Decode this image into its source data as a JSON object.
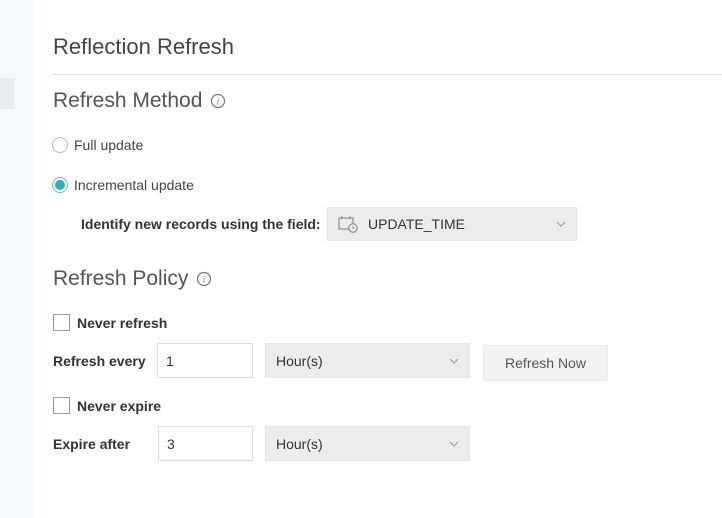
{
  "page_title": "Reflection Refresh",
  "refresh_method": {
    "heading": "Refresh Method",
    "options": [
      {
        "label": "Full update",
        "selected": false
      },
      {
        "label": "Incremental update",
        "selected": true
      }
    ],
    "field_label": "Identify new records using the field:",
    "field_value": "UPDATE_TIME",
    "field_icon": "calendar-clock-icon"
  },
  "refresh_policy": {
    "heading": "Refresh Policy",
    "never_refresh_label": "Never refresh",
    "never_refresh_checked": false,
    "refresh_every_label": "Refresh every",
    "refresh_every_value": "1",
    "refresh_every_unit": "Hour(s)",
    "refresh_now_label": "Refresh Now",
    "never_expire_label": "Never expire",
    "never_expire_checked": false,
    "expire_after_label": "Expire after",
    "expire_after_value": "3",
    "expire_after_unit": "Hour(s)"
  },
  "colors": {
    "accent": "#3aabb8",
    "sidebar": "#f4f9fb"
  }
}
